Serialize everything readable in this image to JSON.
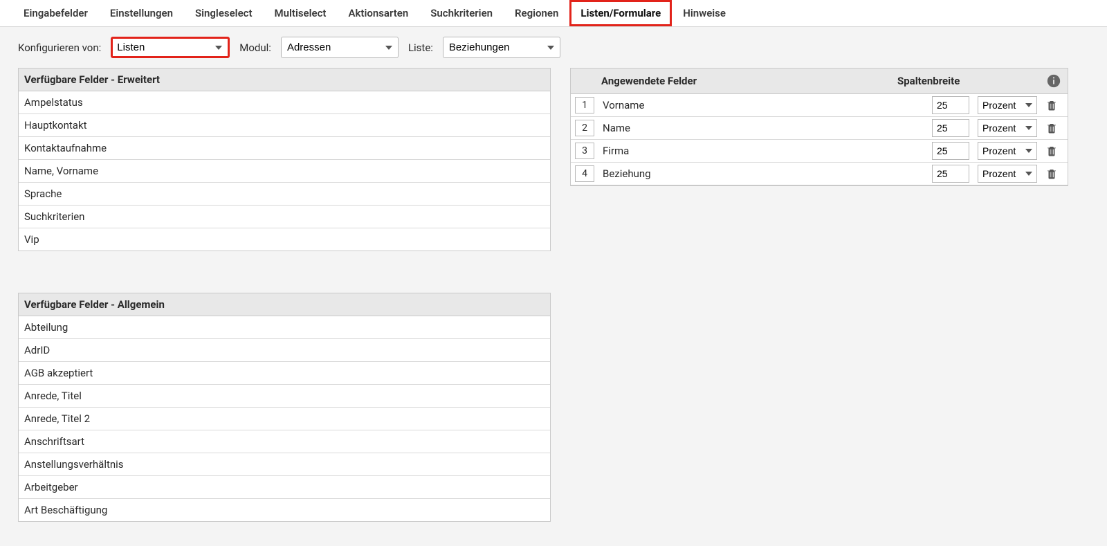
{
  "tabs": [
    {
      "key": "eingabefelder",
      "label": "Eingabefelder",
      "active": false
    },
    {
      "key": "einstellungen",
      "label": "Einstellungen",
      "active": false
    },
    {
      "key": "singleselect",
      "label": "Singleselect",
      "active": false
    },
    {
      "key": "multiselect",
      "label": "Multiselect",
      "active": false
    },
    {
      "key": "aktionsarten",
      "label": "Aktionsarten",
      "active": false
    },
    {
      "key": "suchkriterien",
      "label": "Suchkriterien",
      "active": false
    },
    {
      "key": "regionen",
      "label": "Regionen",
      "active": false
    },
    {
      "key": "listenformulare",
      "label": "Listen/Formulare",
      "active": true
    },
    {
      "key": "hinweise",
      "label": "Hinweise",
      "active": false
    }
  ],
  "config": {
    "configure_label": "Konfigurieren von:",
    "configure_value": "Listen",
    "module_label": "Modul:",
    "module_value": "Adressen",
    "list_label": "Liste:",
    "list_value": "Beziehungen"
  },
  "panels": {
    "erweitert_title": "Verfügbare Felder - Erweitert",
    "erweitert_fields": [
      "Ampelstatus",
      "Hauptkontakt",
      "Kontaktaufnahme",
      "Name, Vorname",
      "Sprache",
      "Suchkriterien",
      "Vip"
    ],
    "allgemein_title": "Verfügbare Felder - Allgemein",
    "allgemein_fields": [
      "Abteilung",
      "AdrID",
      "AGB akzeptiert",
      "Anrede, Titel",
      "Anrede, Titel 2",
      "Anschriftsart",
      "Anstellungsverhältnis",
      "Arbeitgeber",
      "Art Beschäftigung"
    ]
  },
  "applied": {
    "header_name": "Angewendete Felder",
    "header_width": "Spaltenbreite",
    "unit_options": [
      "Prozent"
    ],
    "rows": [
      {
        "order": "1",
        "name": "Vorname",
        "width": "25",
        "unit": "Prozent"
      },
      {
        "order": "2",
        "name": "Name",
        "width": "25",
        "unit": "Prozent"
      },
      {
        "order": "3",
        "name": "Firma",
        "width": "25",
        "unit": "Prozent"
      },
      {
        "order": "4",
        "name": "Beziehung",
        "width": "25",
        "unit": "Prozent"
      }
    ]
  }
}
